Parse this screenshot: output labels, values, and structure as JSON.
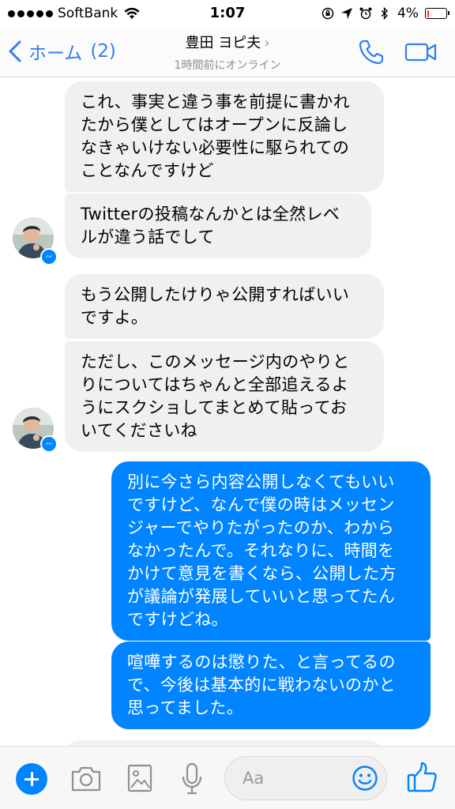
{
  "status_bar": {
    "carrier": "SoftBank",
    "time": "1:07",
    "battery": "4%",
    "battery_level": 0.04,
    "battery_color": "#ff2d2d"
  },
  "nav": {
    "back_label": "ホーム",
    "unread_count": "(2)",
    "contact_name": "豊田 ヨピ夫",
    "chevron": "›",
    "presence": "1時間前にオンライン",
    "accent_color": "#2f7ff0",
    "icons": [
      "back-chevron-icon",
      "phone-icon",
      "video-camera-icon"
    ]
  },
  "messages": [
    {
      "direction": "in",
      "text": "これ、事実と違う事を前提に書かれたから僕としてはオープンに反論しなきゃいけない必要性に駆られてのことなんですけど",
      "lines": [
        "これ、事実と違う事を前提に書かれ",
        "たから僕としてはオープンに反論し",
        "なきゃいけない必要性に駆られての",
        "ことなんですけど"
      ]
    },
    {
      "direction": "in",
      "text": "Twitterの投稿なんかとは全然レベルが違う話でして",
      "lines": [
        "Twitterの投稿なんかとは全然レベ",
        "ルが違う話でして"
      ]
    },
    {
      "direction": "in",
      "text": "もう公開したけりゃ公開すればいいですよ。",
      "lines": [
        "もう公開したけりゃ公開すればいい",
        "ですよ。"
      ]
    },
    {
      "direction": "in",
      "text": "ただし、このメッセージ内のやりとりについてはちゃんと全部追えるようにスクショしてまとめて貼っておいてくださいね",
      "lines": [
        "ただし、このメッセージ内のやりと",
        "りについてはちゃんと全部追えるよ",
        "うにスクショしてまとめて貼ってお",
        "いてくださいね"
      ]
    },
    {
      "direction": "out",
      "text": "別に今さら内容公開しなくてもいいですけど、なんで僕の時はメッセンジャーでやりたがったのか、わからなかったんで。それなりに、時間をかけて意見を書くなら、公開した方が議論が発展していいと思ってたんですけどね。",
      "lines": [
        "別に今さら内容公開しなくてもいい",
        "ですけど、なんで僕の時はメッセン",
        "ジャーでやりたがったのか、わから",
        "なかったんで。それなりに、時間を",
        "かけて意見を書くなら、公開した方",
        "が議論が発展していいと思ってたん",
        "ですけどね。"
      ]
    },
    {
      "direction": "out",
      "text": "喧嘩するのは懲りた、と言ってるので、今後は基本的に戦わないのかと思ってました。",
      "lines": [
        "喧嘩するのは懲りた、と言ってるの",
        "で、今後は基本的に戦わないのかと",
        "思ってました。"
      ]
    }
  ],
  "colors": {
    "incoming_bubble": "#f1f0f0",
    "outgoing_bubble": "#0084ff",
    "messenger_blue": "#0084ff"
  },
  "composer": {
    "placeholder": "Aa",
    "icons": [
      "plus-icon",
      "camera-icon",
      "image-icon",
      "microphone-icon",
      "emoji-icon",
      "thumbs-up-icon"
    ]
  }
}
